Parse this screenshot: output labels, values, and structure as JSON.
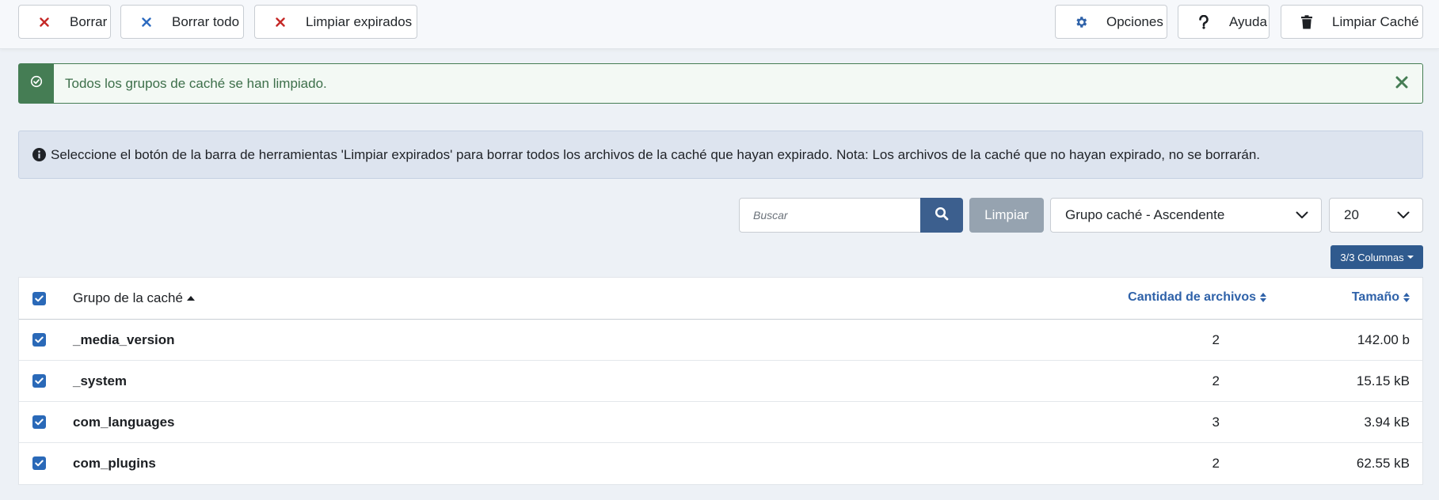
{
  "toolbar": {
    "delete_label": "Borrar",
    "delete_all_label": "Borrar todo",
    "clear_expired_label": "Limpiar expirados",
    "options_label": "Opciones",
    "help_label": "Ayuda",
    "clear_cache_label": "Limpiar Caché"
  },
  "alert": {
    "message": "Todos los grupos de caché se han limpiado."
  },
  "info": {
    "message": "Seleccione el botón de la barra de herramientas 'Limpiar expirados' para borrar todos los archivos de la caché que hayan expirado. Nota: Los archivos de la caché que no hayan expirado, no se borrarán."
  },
  "filters": {
    "search_placeholder": "Buscar",
    "clear_label": "Limpiar",
    "ordering_selected": "Grupo caché - Ascendente",
    "limit_selected": "20",
    "columns_label": "3/3 Columnas"
  },
  "table": {
    "headers": {
      "group": "Grupo de la caché",
      "count": "Cantidad de archivos",
      "size": "Tamaño"
    },
    "rows": [
      {
        "group": "_media_version",
        "count": "2",
        "size": "142.00 b"
      },
      {
        "group": "_system",
        "count": "2",
        "size": "15.15 kB"
      },
      {
        "group": "com_languages",
        "count": "3",
        "size": "3.94 kB"
      },
      {
        "group": "com_plugins",
        "count": "2",
        "size": "62.55 kB"
      }
    ]
  },
  "colors": {
    "success": "#457d54",
    "primary": "#2f5a8e",
    "link": "#2f62a9",
    "danger_icon": "#c52827",
    "checkbox": "#2a69b8"
  },
  "icons": {
    "delete": "x-icon",
    "delete_all": "x-icon",
    "clear_expired": "x-icon",
    "options": "gear-icon",
    "help": "question-icon",
    "clear_cache": "trash-icon",
    "alert": "check-circle-icon",
    "info": "info-circle-icon",
    "search": "search-icon"
  }
}
